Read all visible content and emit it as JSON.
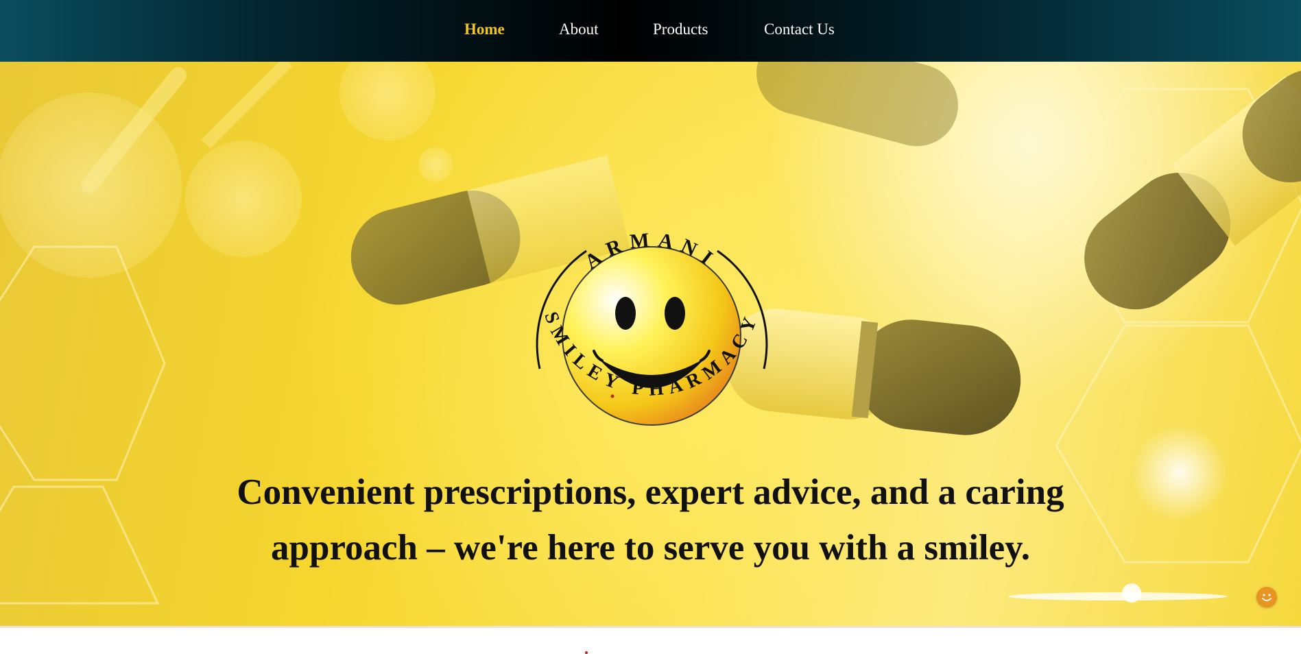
{
  "nav": {
    "items": [
      {
        "label": "Home",
        "active": true
      },
      {
        "label": "About",
        "active": false
      },
      {
        "label": "Products",
        "active": false
      },
      {
        "label": "Contact Us",
        "active": false
      }
    ]
  },
  "hero": {
    "logo": {
      "top_text": "ARMANI",
      "bottom_text": "SMILEY PHARMACY"
    },
    "tagline": {
      "line1": "Convenient prescriptions, expert advice, and a caring",
      "line2": "approach – we're here to serve you with a smiley."
    }
  },
  "chat_widget": {
    "icon": "smiley-chat-icon"
  },
  "colors": {
    "nav_active": "#f2c71c",
    "nav_text": "#ffffff",
    "hero_yellow": "#f6d62e",
    "chat_orange": "#e89422"
  }
}
